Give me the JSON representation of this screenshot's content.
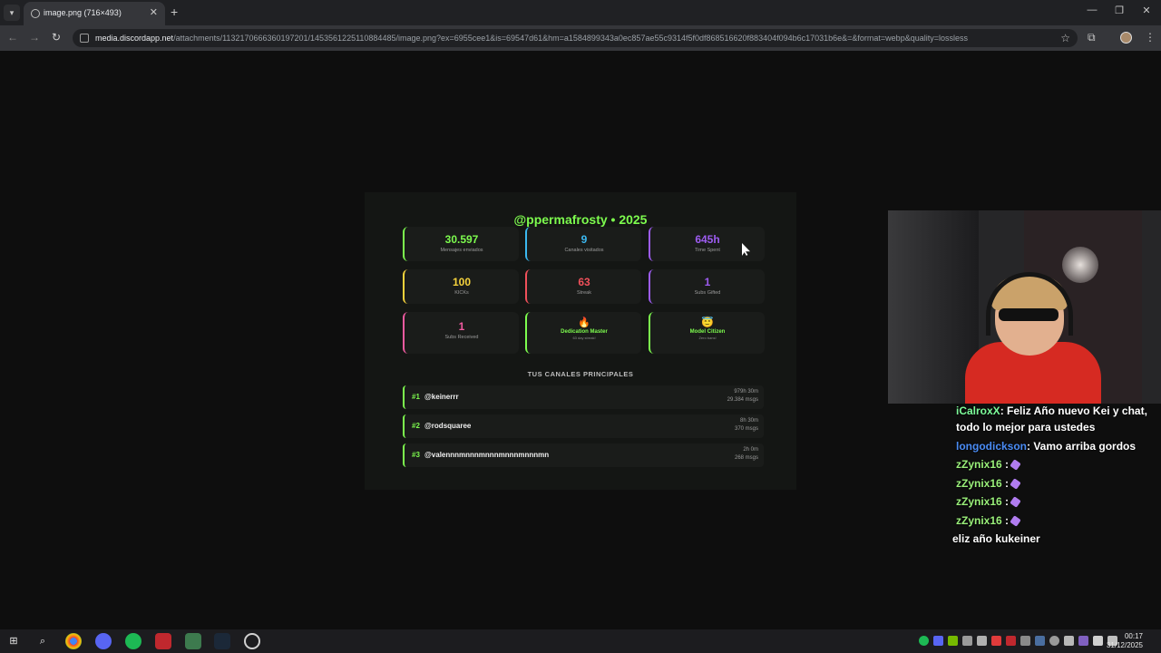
{
  "browser": {
    "tab_title": "image.png (716×493)",
    "url_host": "media.discordapp.net",
    "url_path": "/attachments/1132170666360197201/1453561225110884485/image.png?ex=6955cee1&is=69547d61&hm=a1584899343a0ec857ae55c9314f5f0df868516620f883404f094b6c17031b6e&=&format=webp&quality=lossless"
  },
  "card": {
    "title": "@ppermafrosty • 2025",
    "stats": [
      {
        "value": "30.597",
        "label": "Mensajes enviados",
        "color": "#7dfc4e"
      },
      {
        "value": "9",
        "label": "Canales visitados",
        "color": "#3bb8f0"
      },
      {
        "value": "645h",
        "label": "Time Spent",
        "color": "#9d5cf0"
      },
      {
        "value": "100",
        "label": "KICKs",
        "color": "#f5d23c"
      },
      {
        "value": "63",
        "label": "Streak",
        "color": "#f0505a"
      },
      {
        "value": "1",
        "label": "Subs Gifted",
        "color": "#9d5cf0"
      },
      {
        "value": "1",
        "label": "Subs Received",
        "color": "#f05aa0"
      }
    ],
    "achievements": [
      {
        "emoji": "🔥",
        "name": "Dedication Master",
        "sub": "63 day streak!"
      },
      {
        "emoji": "😇",
        "name": "Model Citizen",
        "sub": "Zero bans!"
      }
    ],
    "section_title": "TUS CANALES PRINCIPALES",
    "channels": [
      {
        "rank": "#1",
        "name": "@keinerrr",
        "time": "979h 30m",
        "msgs": "29.384 msgs"
      },
      {
        "rank": "#2",
        "name": "@rodsquaree",
        "time": "8h 30m",
        "msgs": "370 msgs"
      },
      {
        "rank": "#3",
        "name": "@valennnmnnnmnnnmnnnmnnnmn",
        "time": "2h 0m",
        "msgs": "268 msgs"
      }
    ]
  },
  "chat": [
    {
      "user": "iCalroxX",
      "user_color": "#7dfc9a",
      "text": ": Feliz Año nuevo Kei y chat, todo lo mejor para ustedes",
      "emote": false
    },
    {
      "user": "longodickson",
      "user_color": "#4a8cf5",
      "text": ": Vamo arriba gordos",
      "emote": false
    },
    {
      "user": "zZynix16",
      "user_color": "#9af07a",
      "text": " :",
      "emote": true
    },
    {
      "user": "zZynix16",
      "user_color": "#9af07a",
      "text": " :",
      "emote": true
    },
    {
      "user": "zZynix16",
      "user_color": "#9af07a",
      "text": " :",
      "emote": true
    },
    {
      "user": "zZynix16",
      "user_color": "#9af07a",
      "text": " :",
      "emote": true
    },
    {
      "user": "",
      "user_color": "#ffffff",
      "text": "eliz año kukeiner",
      "emote": false
    }
  ],
  "taskbar": {
    "time": "00:17",
    "date": "31/12/2025"
  }
}
